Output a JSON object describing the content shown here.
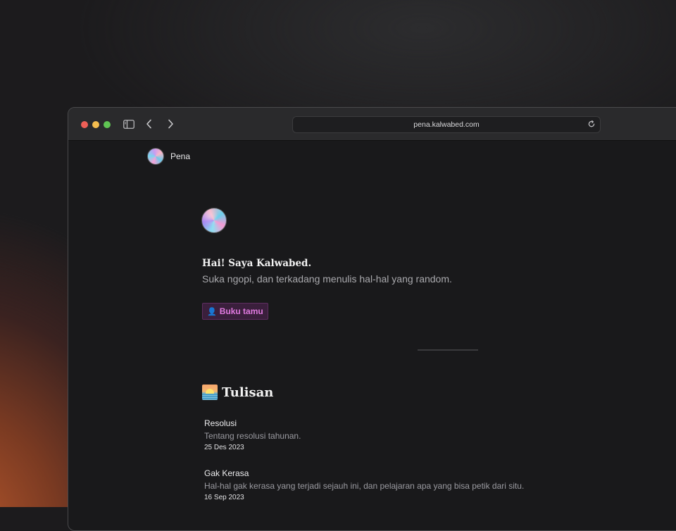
{
  "browser": {
    "url": "pena.kalwabed.com"
  },
  "site": {
    "name": "Pena"
  },
  "profile": {
    "greeting": "Hai! Saya Kalwabed.",
    "tagline": "Suka ngopi, dan terkadang menulis hal-hal yang random.",
    "guestbook_label": "Buku tamu"
  },
  "writings": {
    "title": "Tulisan",
    "posts": [
      {
        "title": "Resolusi",
        "description": "Tentang resolusi tahunan.",
        "date": "25 Des 2023"
      },
      {
        "title": "Gak Kerasa",
        "description": "Hal-hal gak kerasa yang terjadi sejauh ini, dan pelajaran apa yang bisa petik dari situ.",
        "date": "16 Sep 2023"
      }
    ]
  },
  "colors": {
    "accent": "#e07ae0",
    "background": "#19191b"
  }
}
